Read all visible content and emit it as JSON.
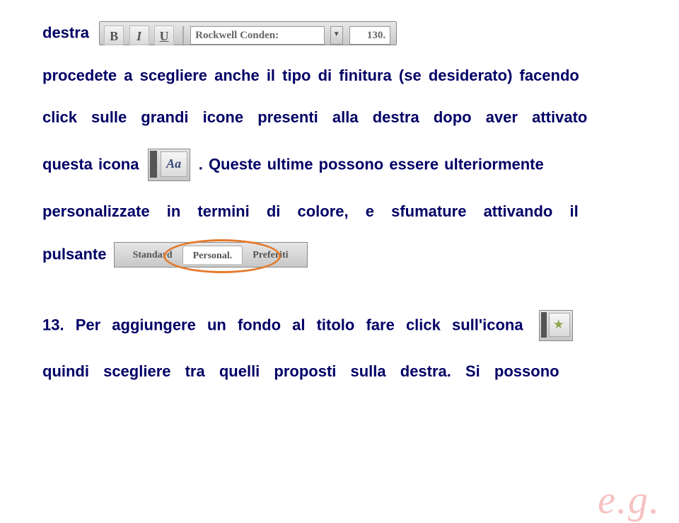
{
  "toolbar": {
    "bold": "B",
    "italic": "I",
    "underline": "U",
    "font_name": "Rockwell Conden:",
    "font_size": "130."
  },
  "aa_icon_label": "Aa",
  "tabs": {
    "standard": "Standard",
    "personal": "Personal.",
    "preferiti": "Preferiti"
  },
  "text": {
    "destra1": "destra",
    "p1": "procedete a scegliere anche il tipo di finitura (se desiderato) facendo",
    "p2": "click sulle grandi icone presenti alla destra dopo aver attivato",
    "p3a": "questa icona ",
    "p3b": ". Queste ultime possono essere ulteriormente",
    "p4": "personalizzate in termini di colore, e sfumature attivando il",
    "p5": "pulsante",
    "p6": "13.  Per aggiungere un fondo al titolo fare click sull'icona ",
    "p7": "quindi scegliere tra quelli proposti sulla destra. Si possono"
  },
  "watermark": "e.g."
}
